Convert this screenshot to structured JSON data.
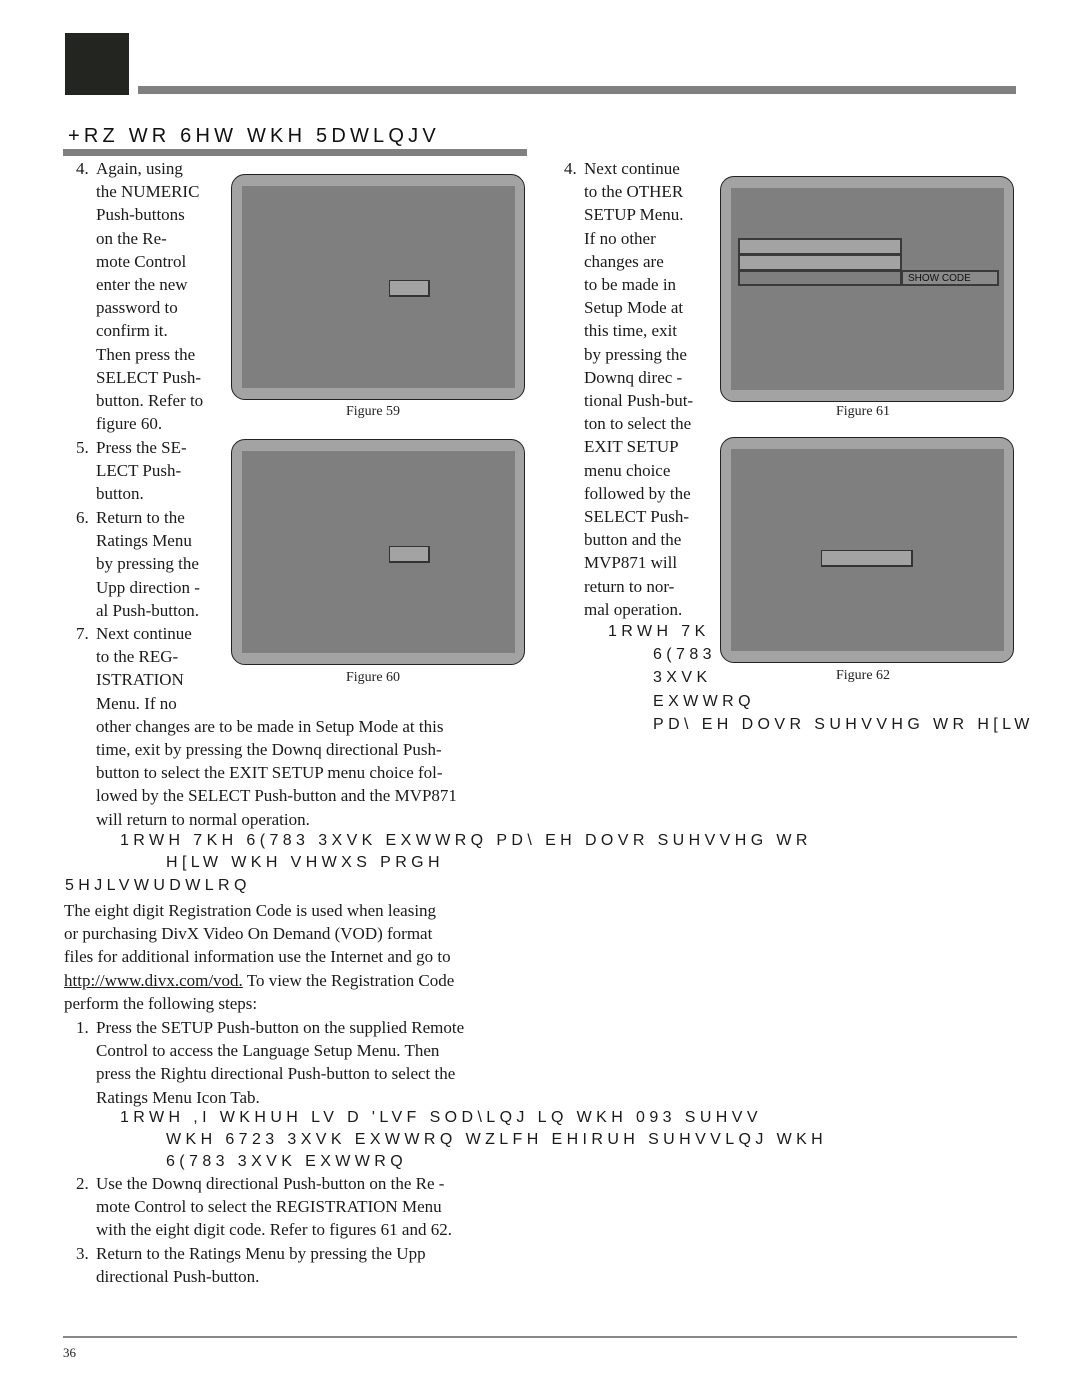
{
  "header": {
    "section_title": "+RZ WR 6HW WKH 5DWLQJV"
  },
  "left_column": {
    "step4": {
      "number": "4.",
      "lines": [
        "Again, using",
        "the NUMERIC",
        "Push-buttons",
        "on the Re-",
        "mote Control",
        "enter the new",
        "password to",
        "confirm it.",
        "Then press the",
        "SELECT Push-",
        "button. Refer to",
        "figure 60."
      ]
    },
    "step5": {
      "number": "5.",
      "lines": [
        "Press the SE-",
        "LECT Push-",
        "button."
      ]
    },
    "step6": {
      "number": "6.",
      "lines": [
        "Return to the",
        "Ratings Menu",
        "by pressing the",
        "Upp direction -",
        "al Push-button."
      ]
    },
    "step7": {
      "number": "7.",
      "lines": [
        "Next continue",
        "to the REG-",
        "ISTRATION",
        "Menu. If no",
        "other changes are to be made in Setup Mode at this",
        "time, exit by pressing the Downq directional Push-",
        "button to select the EXIT SETUP menu choice fol-",
        "lowed by the SELECT Push-button and the MVP871",
        "will return to normal operation."
      ]
    },
    "note1": {
      "lines": [
        "1RWH  7KH 6(783 3XVK EXWWRQ PD\\ EH DOVR SUHVVHG WR",
        "H[LW WKH VHWXS PRGH"
      ]
    },
    "registration": {
      "heading": "5HJLVWUDWLRQ",
      "intro_lines": [
        "The eight digit Registration Code is used when leasing",
        "or purchasing DivX Video On Demand (VOD) format",
        "files for additional information use the Internet and go to"
      ],
      "link_text": "http://www.divx.com/vod.",
      "intro_after_link": " To view the Registration Code",
      "intro_last": "perform the following steps:",
      "step1": {
        "number": "1.",
        "lines": [
          "Press the SETUP Push-button on the supplied Remote",
          "Control to access the Language Setup Menu. Then",
          "press the Rightu directional Push-button to select the",
          "Ratings Menu Icon Tab."
        ]
      },
      "note2": {
        "lines": [
          "1RWH  ,I WKHUH LV D 'LVF SOD\\LQJ LQ WKH 093    SUHVV",
          "WKH 6723 3XVK EXWWRQ WZLFH EHIRUH SUHVVLQJ WKH",
          "6(783 3XVK EXWWRQ"
        ]
      },
      "step2": {
        "number": "2.",
        "lines": [
          "Use the Downq directional Push-button on the Re -",
          "mote Control to select the REGISTRATION Menu",
          "with the eight digit code. Refer to figures 61 and 62."
        ]
      },
      "step3": {
        "number": "3.",
        "lines": [
          "Return to the Ratings Menu by pressing the Upp",
          "directional Push-button."
        ]
      }
    }
  },
  "right_column": {
    "step4": {
      "number": "4.",
      "lines": [
        "Next continue",
        "to the OTHER",
        "SETUP Menu.",
        "If no other",
        "changes are",
        "to be made in",
        "Setup Mode at",
        "this time, exit",
        "by pressing the",
        "Downq direc -",
        "tional Push-but-",
        "ton to select the",
        "EXIT SETUP",
        "menu choice",
        "followed by the",
        "SELECT Push-",
        "button and the",
        "MVP871 will",
        "return to nor-",
        "mal operation."
      ]
    },
    "note": {
      "lines": [
        "1RWH  7K",
        "6(783",
        "3XVK",
        "EXWWRQ",
        "PD\\ EH DOVR SUHVVHG WR H[LW"
      ]
    }
  },
  "figures": {
    "fig59": {
      "caption": "Figure 59"
    },
    "fig60": {
      "caption": "Figure 60"
    },
    "fig61": {
      "caption": "Figure 61",
      "show_code_label": "SHOW CODE"
    },
    "fig62": {
      "caption": "Figure 62"
    }
  },
  "footer": {
    "page_number": "36"
  }
}
